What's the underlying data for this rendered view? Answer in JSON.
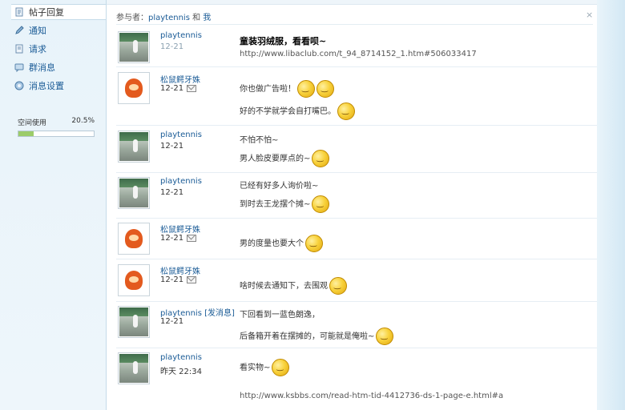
{
  "sidebar": {
    "items": [
      {
        "label": "帖子回复",
        "icon": "document-icon"
      },
      {
        "label": "通知",
        "icon": "pencil-icon"
      },
      {
        "label": "请求",
        "icon": "document-icon"
      },
      {
        "label": "群消息",
        "icon": "chat-icon"
      },
      {
        "label": "消息设置",
        "icon": "gear-icon"
      }
    ],
    "space_label": "空间使用",
    "space_percent": "20.5%",
    "space_fraction": 0.205
  },
  "header": {
    "participants_prefix": "参与者：",
    "participant_1": "playtennis",
    "and": "和",
    "participant_2": "我",
    "close": "×"
  },
  "messages": [
    {
      "user": "playtennis",
      "date": "12-21",
      "lines": [
        "童装羽绒服，看看呗~",
        "http://www.libaclub.com/t_94_8714152_1.htm#506033417"
      ]
    },
    {
      "user": "松鼠鳄牙姝",
      "date": "12-21",
      "lines": [
        "你也做广告啦！",
        "好的不学就学会自打嘴巴。"
      ]
    },
    {
      "user": "playtennis",
      "date": "12-21",
      "lines": [
        "不怕不怕~",
        "男人脸皮要厚点的~"
      ]
    },
    {
      "user": "playtennis",
      "date": "12-21",
      "lines": [
        "已经有好多人询价啦~",
        "到时去王龙摆个摊~"
      ]
    },
    {
      "user": "松鼠鳄牙姝",
      "date": "12-21",
      "lines": [
        "男的度量也要大个"
      ]
    },
    {
      "user": "松鼠鳄牙姝",
      "date": "12-21",
      "lines": [
        "啥时候去通知下，去围观"
      ]
    },
    {
      "user": "playtennis",
      "user_suffix": "[发消息]",
      "date": "12-21",
      "lines": [
        "下回看到一蓝色朗逸，",
        "后备箱开着在摆摊的，可能就是俺啦~"
      ]
    },
    {
      "user": "playtennis",
      "date": "昨天 22:34",
      "lines": [
        "看实物~",
        "http://www.ksbbs.com/read-htm-tid-4412736-ds-1-page-e.html#a"
      ]
    }
  ]
}
